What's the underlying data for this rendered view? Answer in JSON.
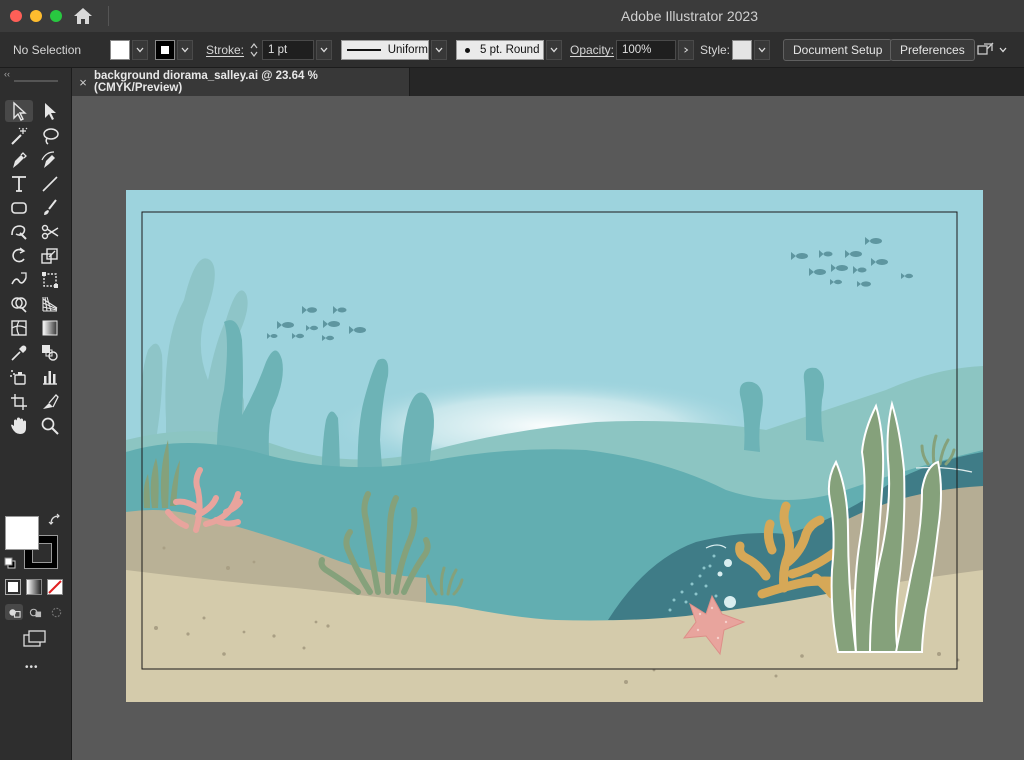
{
  "window": {
    "app_title": "Adobe Illustrator 2023",
    "traffic_lights": {
      "close": "#ff5f57",
      "minimize": "#febc2e",
      "zoom": "#28c840"
    }
  },
  "control_bar": {
    "selection_label": "No Selection",
    "fill_color": "#ffffff",
    "stroke_label": "Stroke:",
    "stroke_weight": "1 pt",
    "profile_label": "Uniform",
    "brush_label": "5 pt. Round",
    "opacity_label": "Opacity:",
    "opacity_value": "100%",
    "style_label": "Style:",
    "document_setup_button": "Document Setup",
    "preferences_button": "Preferences"
  },
  "document": {
    "tab_title": "background diorama_salley.ai @ 23.64 % (CMYK/Preview)",
    "close_glyph": "×"
  },
  "toolbar": {
    "more_glyph": "•••",
    "collapse_glyph": "‹‹",
    "tools": [
      "selection-tool",
      "direct-selection-tool",
      "magic-wand-tool",
      "lasso-tool",
      "pen-tool",
      "curvature-tool",
      "type-tool",
      "line-segment-tool",
      "rectangle-tool",
      "paintbrush-tool",
      "shaper-tool",
      "scissors-tool",
      "rotate-tool",
      "scale-tool",
      "warp-tool",
      "free-transform-tool",
      "shape-builder-tool",
      "perspective-grid-tool",
      "mesh-tool",
      "gradient-tool",
      "eyedropper-tool",
      "blend-tool",
      "symbol-sprayer-tool",
      "column-graph-tool",
      "artboard-tool",
      "slice-tool",
      "hand-tool",
      "zoom-tool"
    ],
    "fill_swatch_color": "#ffffff",
    "stroke_swatch_color": "#000000"
  },
  "artwork": {
    "sky_color": "#9dd3dd",
    "sand_color": "#d4cbab",
    "seaweed_color": "#85a17b",
    "coral_pink": "#e8a49d",
    "coral_orange": "#d6a857",
    "starfish_color": "#e8a49d",
    "teal_color": "#5fa9ad",
    "dark_teal": "#3f7c87"
  }
}
